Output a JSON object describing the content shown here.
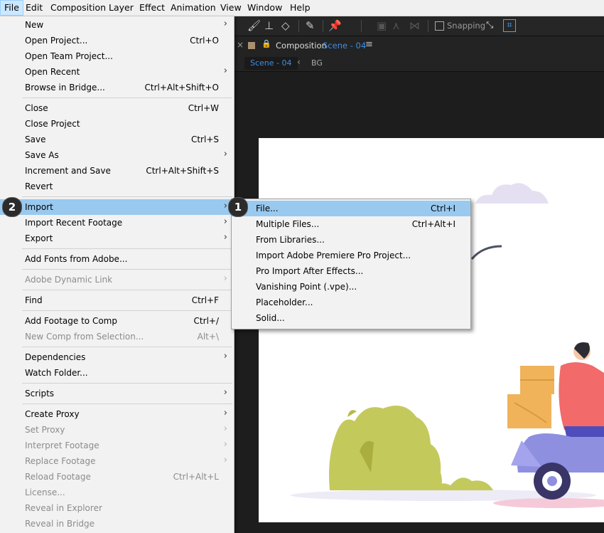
{
  "menubar": {
    "items": [
      "File",
      "Edit",
      "Composition",
      "Layer",
      "Effect",
      "Animation",
      "View",
      "Window",
      "Help"
    ]
  },
  "toolbar": {
    "snapping_label": "Snapping"
  },
  "panel": {
    "close_glyph": "×",
    "title": "Composition",
    "comp_name": "Scene - 04",
    "menu_glyph": "≡",
    "breadcrumb_active": "Scene - 04",
    "breadcrumb_arrow": "‹",
    "breadcrumb_next": "BG"
  },
  "file_menu": {
    "groups": [
      [
        {
          "label": "New",
          "shortcut": "",
          "submenu": true,
          "disabled": false
        },
        {
          "label": "Open Project...",
          "shortcut": "Ctrl+O",
          "submenu": false,
          "disabled": false
        },
        {
          "label": "Open Team Project...",
          "shortcut": "",
          "submenu": false,
          "disabled": false
        },
        {
          "label": "Open Recent",
          "shortcut": "",
          "submenu": true,
          "disabled": false
        },
        {
          "label": "Browse in Bridge...",
          "shortcut": "Ctrl+Alt+Shift+O",
          "submenu": false,
          "disabled": false
        }
      ],
      [
        {
          "label": "Close",
          "shortcut": "Ctrl+W",
          "submenu": false,
          "disabled": false
        },
        {
          "label": "Close Project",
          "shortcut": "",
          "submenu": false,
          "disabled": false
        },
        {
          "label": "Save",
          "shortcut": "Ctrl+S",
          "submenu": false,
          "disabled": false
        },
        {
          "label": "Save As",
          "shortcut": "",
          "submenu": true,
          "disabled": false
        },
        {
          "label": "Increment and Save",
          "shortcut": "Ctrl+Alt+Shift+S",
          "submenu": false,
          "disabled": false
        },
        {
          "label": "Revert",
          "shortcut": "",
          "submenu": false,
          "disabled": false
        }
      ],
      [
        {
          "label": "Import",
          "shortcut": "",
          "submenu": true,
          "disabled": false,
          "highlighted": true
        },
        {
          "label": "Import Recent Footage",
          "shortcut": "",
          "submenu": true,
          "disabled": false
        },
        {
          "label": "Export",
          "shortcut": "",
          "submenu": true,
          "disabled": false
        }
      ],
      [
        {
          "label": "Add Fonts from Adobe...",
          "shortcut": "",
          "submenu": false,
          "disabled": false
        }
      ],
      [
        {
          "label": "Adobe Dynamic Link",
          "shortcut": "",
          "submenu": true,
          "disabled": true
        }
      ],
      [
        {
          "label": "Find",
          "shortcut": "Ctrl+F",
          "submenu": false,
          "disabled": false
        }
      ],
      [
        {
          "label": "Add Footage to Comp",
          "shortcut": "Ctrl+/",
          "submenu": false,
          "disabled": false
        },
        {
          "label": "New Comp from Selection...",
          "shortcut": "Alt+\\",
          "submenu": false,
          "disabled": true
        }
      ],
      [
        {
          "label": "Dependencies",
          "shortcut": "",
          "submenu": true,
          "disabled": false
        },
        {
          "label": "Watch Folder...",
          "shortcut": "",
          "submenu": false,
          "disabled": false
        }
      ],
      [
        {
          "label": "Scripts",
          "shortcut": "",
          "submenu": true,
          "disabled": false
        }
      ],
      [
        {
          "label": "Create Proxy",
          "shortcut": "",
          "submenu": true,
          "disabled": false
        },
        {
          "label": "Set Proxy",
          "shortcut": "",
          "submenu": true,
          "disabled": true
        },
        {
          "label": "Interpret Footage",
          "shortcut": "",
          "submenu": true,
          "disabled": true
        },
        {
          "label": "Replace Footage",
          "shortcut": "",
          "submenu": true,
          "disabled": true
        },
        {
          "label": "Reload Footage",
          "shortcut": "Ctrl+Alt+L",
          "submenu": false,
          "disabled": true
        },
        {
          "label": "License...",
          "shortcut": "",
          "submenu": false,
          "disabled": true
        },
        {
          "label": "Reveal in Explorer",
          "shortcut": "",
          "submenu": false,
          "disabled": true
        },
        {
          "label": "Reveal in Bridge",
          "shortcut": "",
          "submenu": false,
          "disabled": true
        }
      ]
    ]
  },
  "import_submenu": {
    "items": [
      {
        "label": "File...",
        "shortcut": "Ctrl+I",
        "highlighted": true
      },
      {
        "label": "Multiple Files...",
        "shortcut": "Ctrl+Alt+I"
      },
      {
        "label": "From Libraries...",
        "shortcut": ""
      },
      {
        "label": "Import Adobe Premiere Pro Project...",
        "shortcut": ""
      },
      {
        "label": "Pro Import After Effects...",
        "shortcut": ""
      },
      {
        "label": "Vanishing Point (.vpe)...",
        "shortcut": ""
      },
      {
        "label": "Placeholder...",
        "shortcut": ""
      },
      {
        "label": "Solid...",
        "shortcut": ""
      }
    ]
  },
  "annotations": {
    "badge_import": "2",
    "badge_file": "1"
  },
  "colors": {
    "menu_bg": "#f2f2f2",
    "highlight": "#99c9ef",
    "comp_name_blue": "#3d8ee6",
    "bush": "#c4c95c",
    "rider_shirt": "#f26a6a",
    "scooter": "#8f8fe0",
    "box": "#f0b35a"
  },
  "submenu_arrow_glyph": "›"
}
